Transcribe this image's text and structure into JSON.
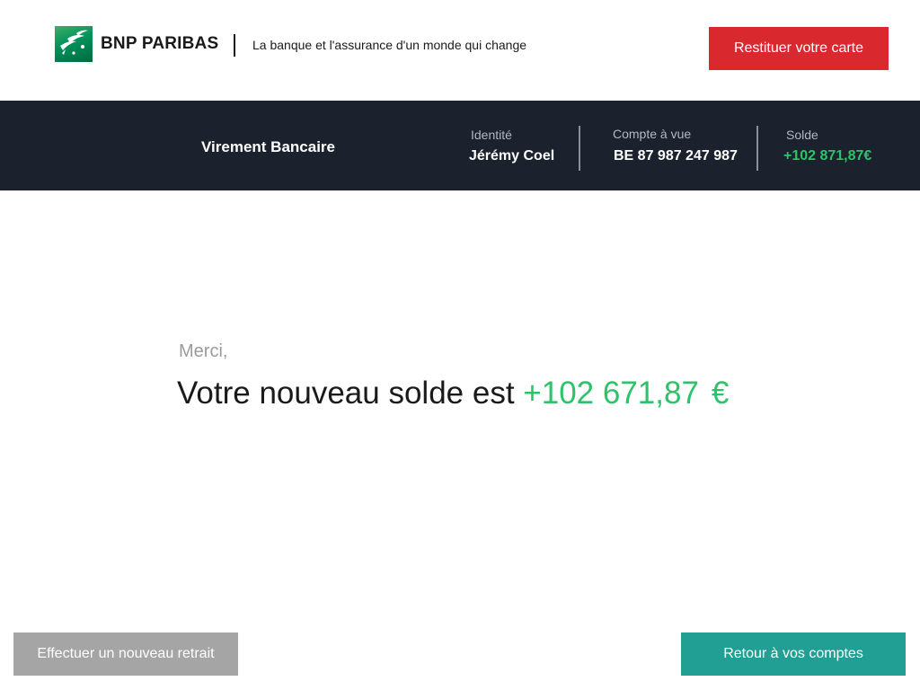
{
  "header": {
    "brand_name": "BNP PARIBAS",
    "tagline": "La banque et l'assurance d'un monde qui change",
    "logo_icon": "bnp-paribas-stars-logo-icon",
    "restituer_label": "Restituer votre carte"
  },
  "infobar": {
    "title": "Virement Bancaire",
    "identity_label": "Identité",
    "identity_value": "Jérémy Coel",
    "account_label": "Compte à vue",
    "account_value": "BE 87 987 247 987",
    "balance_label": "Solde",
    "balance_value": "+102 871,87€"
  },
  "message": {
    "thanks": "Merci,",
    "prefix": "Votre nouveau solde est",
    "amount": "+102 671,87",
    "currency": "€"
  },
  "footer": {
    "new_withdrawal_label": "Effectuer un nouveau retrait",
    "back_to_accounts_label": "Retour à vos comptes"
  },
  "colors": {
    "brand_green": "#00915a",
    "danger_red": "#d9292f",
    "dark_bar": "#1b222e",
    "positive_green": "#2ec26a",
    "teal": "#229f94",
    "muted_gray": "#a5a5a5"
  }
}
